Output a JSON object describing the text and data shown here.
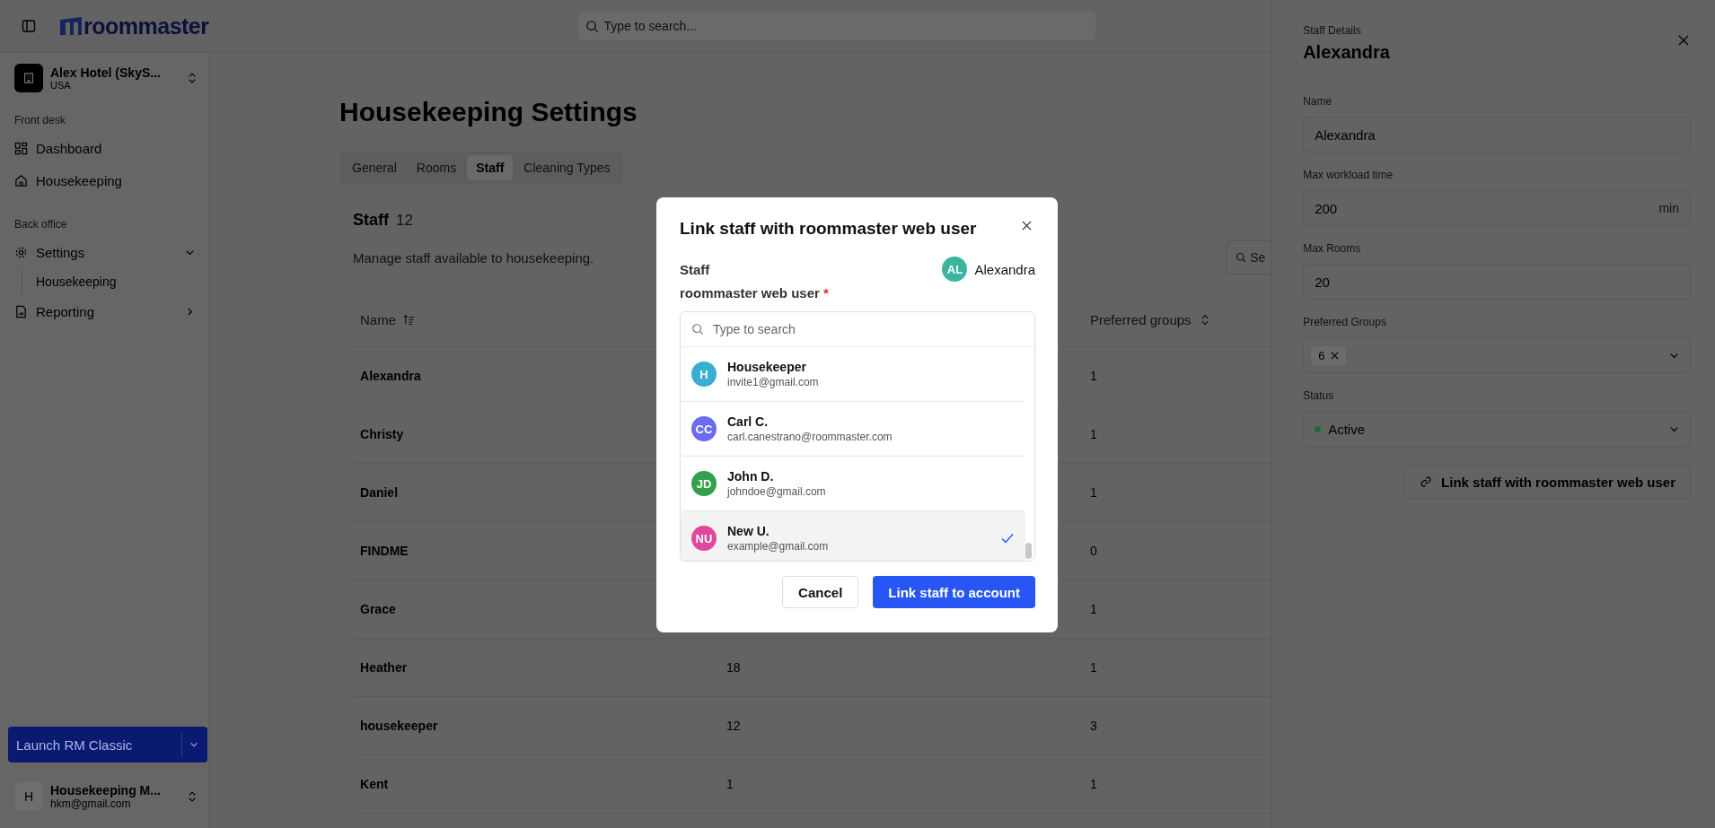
{
  "app": {
    "logo": "roommaster",
    "search_placeholder": "Type to search..."
  },
  "sidebar": {
    "hotel": {
      "name": "Alex Hotel (SkyS...",
      "country": "USA"
    },
    "sections": [
      {
        "title": "Front desk",
        "items": [
          {
            "label": "Dashboard",
            "kind": "dashboard"
          },
          {
            "label": "Housekeeping",
            "kind": "home"
          }
        ]
      },
      {
        "title": "Back office",
        "items": [
          {
            "label": "Settings",
            "kind": "settings",
            "expanded": true,
            "children": [
              {
                "label": "Housekeeping"
              }
            ]
          },
          {
            "label": "Reporting",
            "kind": "report",
            "expanded": false
          }
        ]
      }
    ],
    "launch_button": "Launch RM Classic",
    "user": {
      "initial": "H",
      "name": "Housekeeping M...",
      "email": "hkm@gmail.com"
    }
  },
  "page": {
    "title": "Housekeeping Settings",
    "tabs": [
      {
        "label": "General",
        "selected": false
      },
      {
        "label": "Rooms",
        "selected": false
      },
      {
        "label": "Staff",
        "selected": true
      },
      {
        "label": "Cleaning Types",
        "selected": false
      }
    ],
    "section": {
      "title": "Staff",
      "count": "12",
      "description": "Manage staff available to housekeeping."
    },
    "search_placeholder": "Se",
    "table": {
      "columns": [
        "Name",
        "Preferred groups"
      ],
      "rows": [
        {
          "name": "Alexandra",
          "preferred_groups": "1"
        },
        {
          "name": "Christy",
          "preferred_groups": "1"
        },
        {
          "name": "Daniel",
          "preferred_groups": "1"
        },
        {
          "name": "FINDME",
          "preferred_groups": "0"
        },
        {
          "name": "Grace",
          "preferred_groups": "1"
        },
        {
          "name": "Heather",
          "column_2": "18",
          "preferred_groups": "1"
        },
        {
          "name": "housekeeper",
          "column_2": "12",
          "preferred_groups": "3"
        },
        {
          "name": "Kent",
          "column_2": "1",
          "preferred_groups": "1"
        }
      ]
    }
  },
  "details": {
    "eyebrow": "Staff Details",
    "title": "Alexandra",
    "fields": [
      {
        "label": "Name",
        "kind": "text",
        "value": "Alexandra"
      },
      {
        "label": "Max workload time",
        "kind": "text",
        "value": "200",
        "suffix": "min"
      },
      {
        "label": "Max Rooms",
        "kind": "text",
        "value": "20"
      },
      {
        "label": "Preferred Groups",
        "kind": "tags",
        "tags": [
          "6"
        ]
      },
      {
        "label": "Status",
        "kind": "status",
        "value": "Active",
        "color": "#1f6b31"
      }
    ],
    "link_button": "Link staff with roommaster web user"
  },
  "modal": {
    "title": "Link staff with roommaster web user",
    "staff_label": "Staff",
    "staff": {
      "initials": "AL",
      "name": "Alexandra",
      "color": "#3ab5a0"
    },
    "user_label": "roommaster web user",
    "required_mark": "*",
    "search_placeholder": "Type to search",
    "options": [
      {
        "initials": "H",
        "name": "Housekeeper",
        "email": "invite1@gmail.com",
        "color": "#3aaed0",
        "selected": false
      },
      {
        "initials": "CC",
        "name": "Carl C.",
        "email": "carl.canestrano@roommaster.com",
        "color": "#6b6cf0",
        "selected": false
      },
      {
        "initials": "JD",
        "name": "John D.",
        "email": "johndoe@gmail.com",
        "color": "#34a04a",
        "selected": false
      },
      {
        "initials": "NU",
        "name": "New U.",
        "email": "example@gmail.com",
        "color": "#e0489e",
        "selected": true
      }
    ],
    "cancel": "Cancel",
    "confirm": "Link staff to account"
  }
}
